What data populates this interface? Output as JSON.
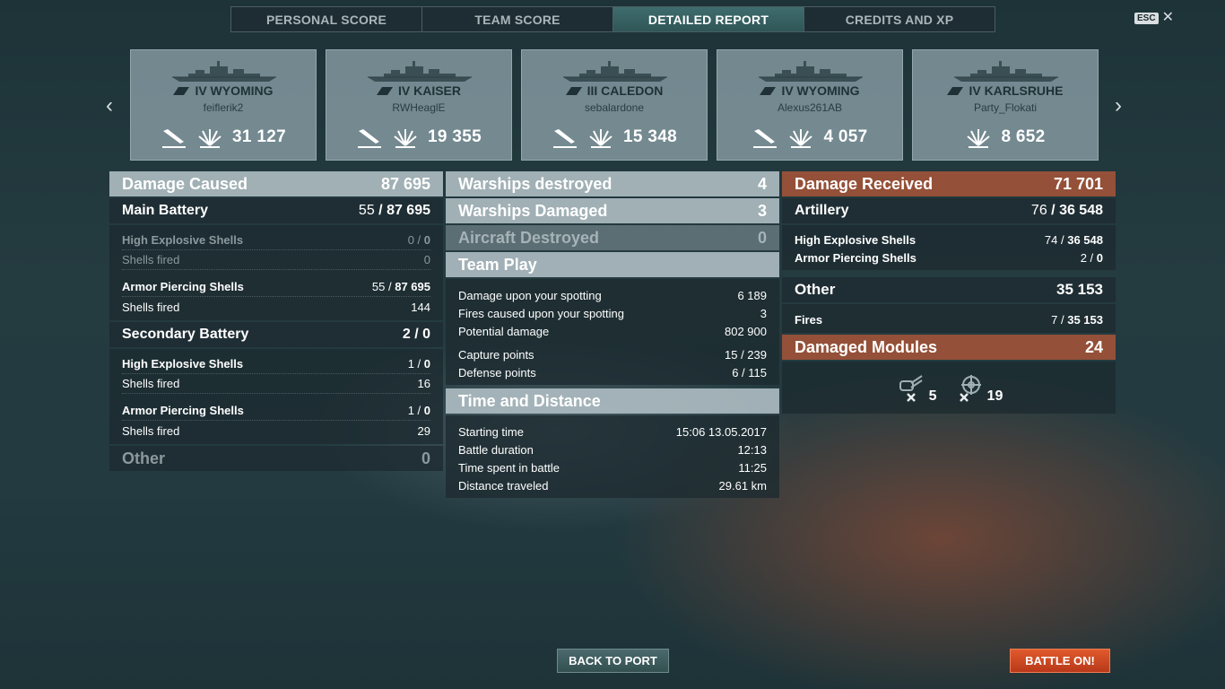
{
  "tabs": [
    {
      "label": "PERSONAL SCORE"
    },
    {
      "label": "TEAM SCORE"
    },
    {
      "label": "DETAILED REPORT"
    },
    {
      "label": "CREDITS AND XP"
    }
  ],
  "active_tab": "DETAILED REPORT",
  "esc": {
    "key": "ESC",
    "close": "✕"
  },
  "carousel": {
    "prev": "‹",
    "next": "›"
  },
  "ships": [
    {
      "name": "IV WYOMING",
      "player": "feiflerik2",
      "damage": "31 127",
      "sunk_icon": true
    },
    {
      "name": "IV KAISER",
      "player": "RWHeaglE",
      "damage": "19 355",
      "sunk_icon": true
    },
    {
      "name": "III CALEDON",
      "player": "sebalardone",
      "damage": "15 348",
      "sunk_icon": true
    },
    {
      "name": "IV WYOMING",
      "player": "Alexus261AB",
      "damage": "4 057",
      "sunk_icon": true
    },
    {
      "name": "IV KARLSRUHE",
      "player": "Party_Flokati",
      "damage": "8 652",
      "sunk_icon": false
    }
  ],
  "damage_caused": {
    "label": "Damage Caused",
    "value": "87 695",
    "main_battery": {
      "label": "Main Battery",
      "hits": "55",
      "sep": " / ",
      "dmg": "87 695",
      "he": {
        "label": "High Explosive Shells",
        "hits": "0",
        "dmg": "0",
        "fired_label": "Shells fired",
        "fired": "0"
      },
      "ap": {
        "label": "Armor Piercing Shells",
        "hits": "55",
        "dmg": "87 695",
        "fired_label": "Shells fired",
        "fired": "144"
      }
    },
    "secondary": {
      "label": "Secondary Battery",
      "hits": "2",
      "dmg": "0",
      "he": {
        "label": "High Explosive Shells",
        "hits": "1",
        "dmg": "0",
        "fired_label": "Shells fired",
        "fired": "16"
      },
      "ap": {
        "label": "Armor Piercing Shells",
        "hits": "1",
        "dmg": "0",
        "fired_label": "Shells fired",
        "fired": "29"
      }
    },
    "other": {
      "label": "Other",
      "value": "0"
    }
  },
  "middle": {
    "destroyed": {
      "label": "Warships destroyed",
      "value": "4"
    },
    "damaged": {
      "label": "Warships Damaged",
      "value": "3"
    },
    "aircraft": {
      "label": "Aircraft Destroyed",
      "value": "0"
    },
    "team_play": {
      "label": "Team Play",
      "rows": [
        {
          "label": "Damage upon your spotting",
          "value": "6 189"
        },
        {
          "label": "Fires caused upon your spotting",
          "value": "3"
        },
        {
          "label": "Potential damage",
          "value": "802 900"
        },
        {
          "label": "Capture points",
          "value": "15 / 239"
        },
        {
          "label": "Defense points",
          "value": "6 / 115"
        }
      ]
    },
    "time": {
      "label": "Time and Distance",
      "rows": [
        {
          "label": "Starting time",
          "value": "15:06  13.05.2017"
        },
        {
          "label": "Battle duration",
          "value": "12:13"
        },
        {
          "label": "Time spent in battle",
          "value": "11:25"
        },
        {
          "label": "Distance traveled",
          "value": "29.61 km"
        }
      ]
    }
  },
  "damage_received": {
    "label": "Damage Received",
    "value": "71 701",
    "artillery": {
      "label": "Artillery",
      "hits": "76",
      "dmg": "36 548",
      "he": {
        "label": "High Explosive Shells",
        "hits": "74",
        "dmg": "36 548"
      },
      "ap": {
        "label": "Armor Piercing Shells",
        "hits": "2",
        "dmg": "0"
      }
    },
    "other": {
      "label": "Other",
      "value": "35 153",
      "fires": {
        "label": "Fires",
        "hits": "7",
        "dmg": "35 153"
      }
    },
    "modules": {
      "label": "Damaged Modules",
      "value": "24",
      "items": [
        {
          "icon": "gun-module-icon",
          "count": "5"
        },
        {
          "icon": "steering-module-icon",
          "count": "19"
        }
      ]
    }
  },
  "buttons": {
    "back": "BACK TO PORT",
    "battle": "BATTLE ON!"
  }
}
